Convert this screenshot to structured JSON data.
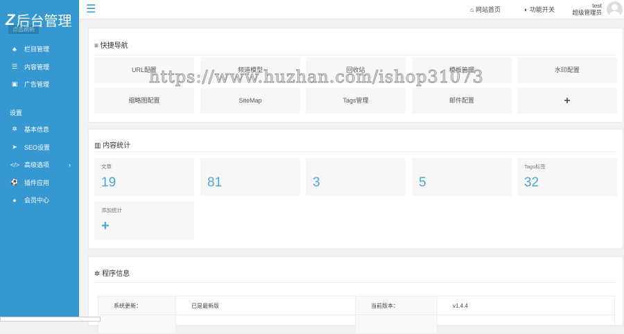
{
  "sidebar": {
    "logo_letter": "Z",
    "logo_text": "后台管理",
    "refresh": "点击刷新",
    "items": [
      {
        "label": "栏目管理",
        "icon": "sitemap-icon"
      },
      {
        "label": "内容管理",
        "icon": "list-icon"
      },
      {
        "label": "广告管理",
        "icon": "image-icon"
      }
    ],
    "group": "设置",
    "settings": [
      {
        "label": "基本信息",
        "icon": "gear-icon"
      },
      {
        "label": "SEO设置",
        "icon": "paper-plane-icon"
      },
      {
        "label": "高级选项",
        "icon": "code-icon"
      },
      {
        "label": "插件应用",
        "icon": "soccer-icon"
      },
      {
        "label": "会员中心",
        "icon": "user-icon"
      }
    ]
  },
  "topbar": {
    "home": "网站首页",
    "toggle": "功能开关",
    "username": "test",
    "role": "超级管理员"
  },
  "quicknav": {
    "title": "快捷导航",
    "items": [
      "URL配置",
      "频道模型",
      "回收站",
      "模板管理",
      "水印配置",
      "缩略图配置",
      "SiteMap",
      "Tags管理",
      "邮件配置",
      "+"
    ]
  },
  "stats": {
    "title": "内容统计",
    "items": [
      {
        "label": "文章",
        "value": "19"
      },
      {
        "label": "",
        "value": "81"
      },
      {
        "label": "",
        "value": "3"
      },
      {
        "label": "",
        "value": "5"
      },
      {
        "label": "Tags标签",
        "value": "32"
      }
    ],
    "add_label": "添加统计",
    "add_icon": "+"
  },
  "info": {
    "title": "程序信息",
    "rows": [
      {
        "k1": "系统更新：",
        "v1": "已是最新版",
        "k2": "当前版本：",
        "v2": "v1.4.4"
      }
    ]
  },
  "watermark": "https://www.huzhan.com/ishop31073",
  "colors": {
    "sidebar": "#3598d1",
    "accent": "#4aa8d6"
  }
}
